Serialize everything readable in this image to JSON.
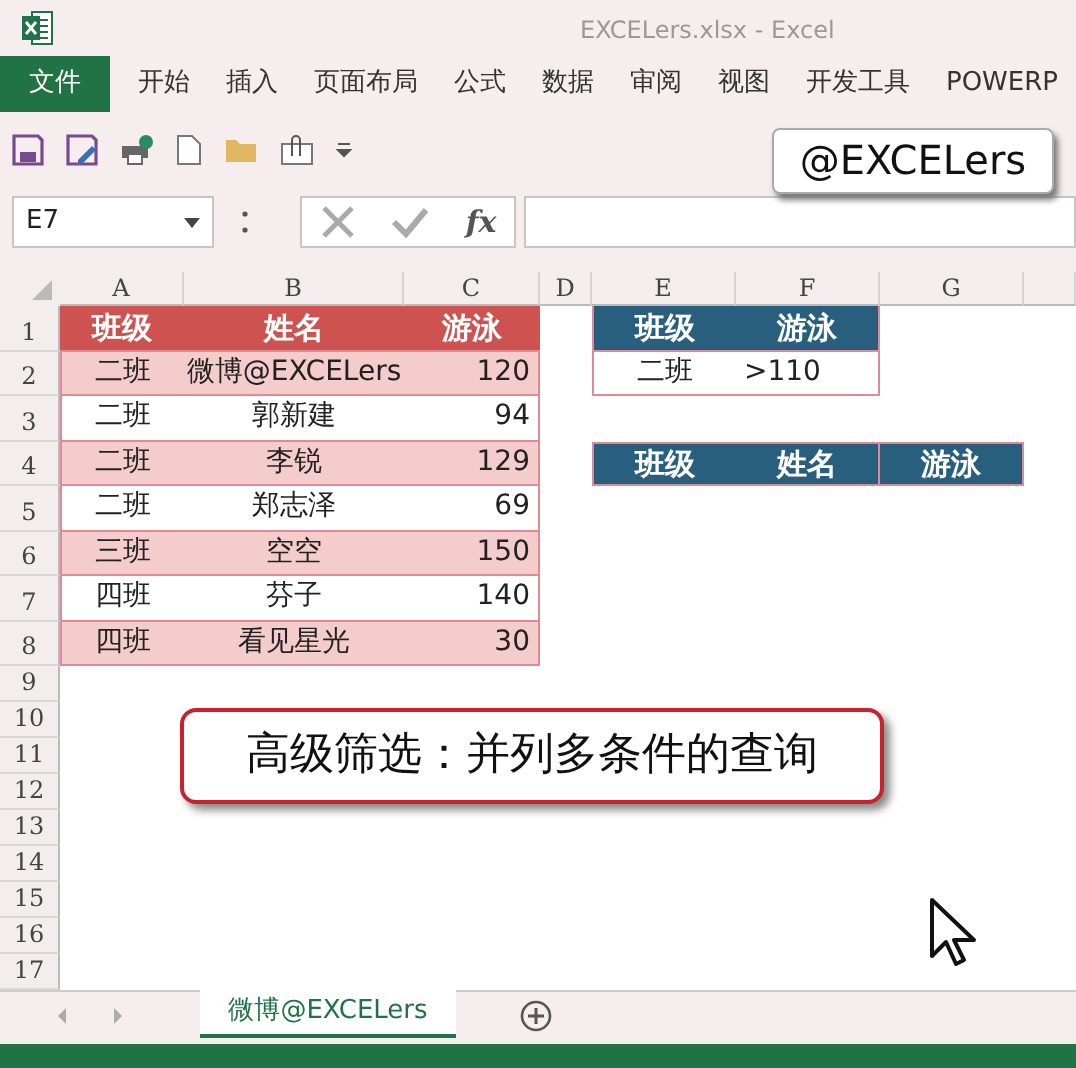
{
  "window": {
    "title": "EXCELers.xlsx - Excel"
  },
  "file_button": "文件",
  "ribbon_tabs": [
    "开始",
    "插入",
    "页面布局",
    "公式",
    "数据",
    "审阅",
    "视图",
    "开发工具",
    "POWERP"
  ],
  "overlay_label": "@EXCELers",
  "name_box": "E7",
  "function_label": "fx",
  "columns": [
    "A",
    "B",
    "C",
    "D",
    "E",
    "F",
    "G"
  ],
  "row_numbers": [
    "1",
    "2",
    "3",
    "4",
    "5",
    "6",
    "7",
    "8",
    "9",
    "10",
    "11",
    "12",
    "13",
    "14",
    "15",
    "16",
    "17"
  ],
  "data_table": {
    "columns": [
      "班级",
      "姓名",
      "游泳"
    ],
    "rows": [
      [
        "二班",
        "微博@EXCELers",
        "120"
      ],
      [
        "二班",
        "郭新建",
        "94"
      ],
      [
        "二班",
        "李锐",
        "129"
      ],
      [
        "二班",
        "郑志泽",
        "69"
      ],
      [
        "三班",
        "空空",
        "150"
      ],
      [
        "四班",
        "芬子",
        "140"
      ],
      [
        "四班",
        "看见星光",
        "30"
      ]
    ]
  },
  "criteria_table": {
    "columns": [
      "班级",
      "游泳"
    ],
    "rows": [
      [
        "二班",
        ">110"
      ]
    ]
  },
  "output_table": {
    "columns": [
      "班级",
      "姓名",
      "游泳"
    ]
  },
  "callout": "高级筛选：并列多条件的查询",
  "sheet_tabs": [
    {
      "label": "微博@EXCELers",
      "selected": true
    }
  ]
}
